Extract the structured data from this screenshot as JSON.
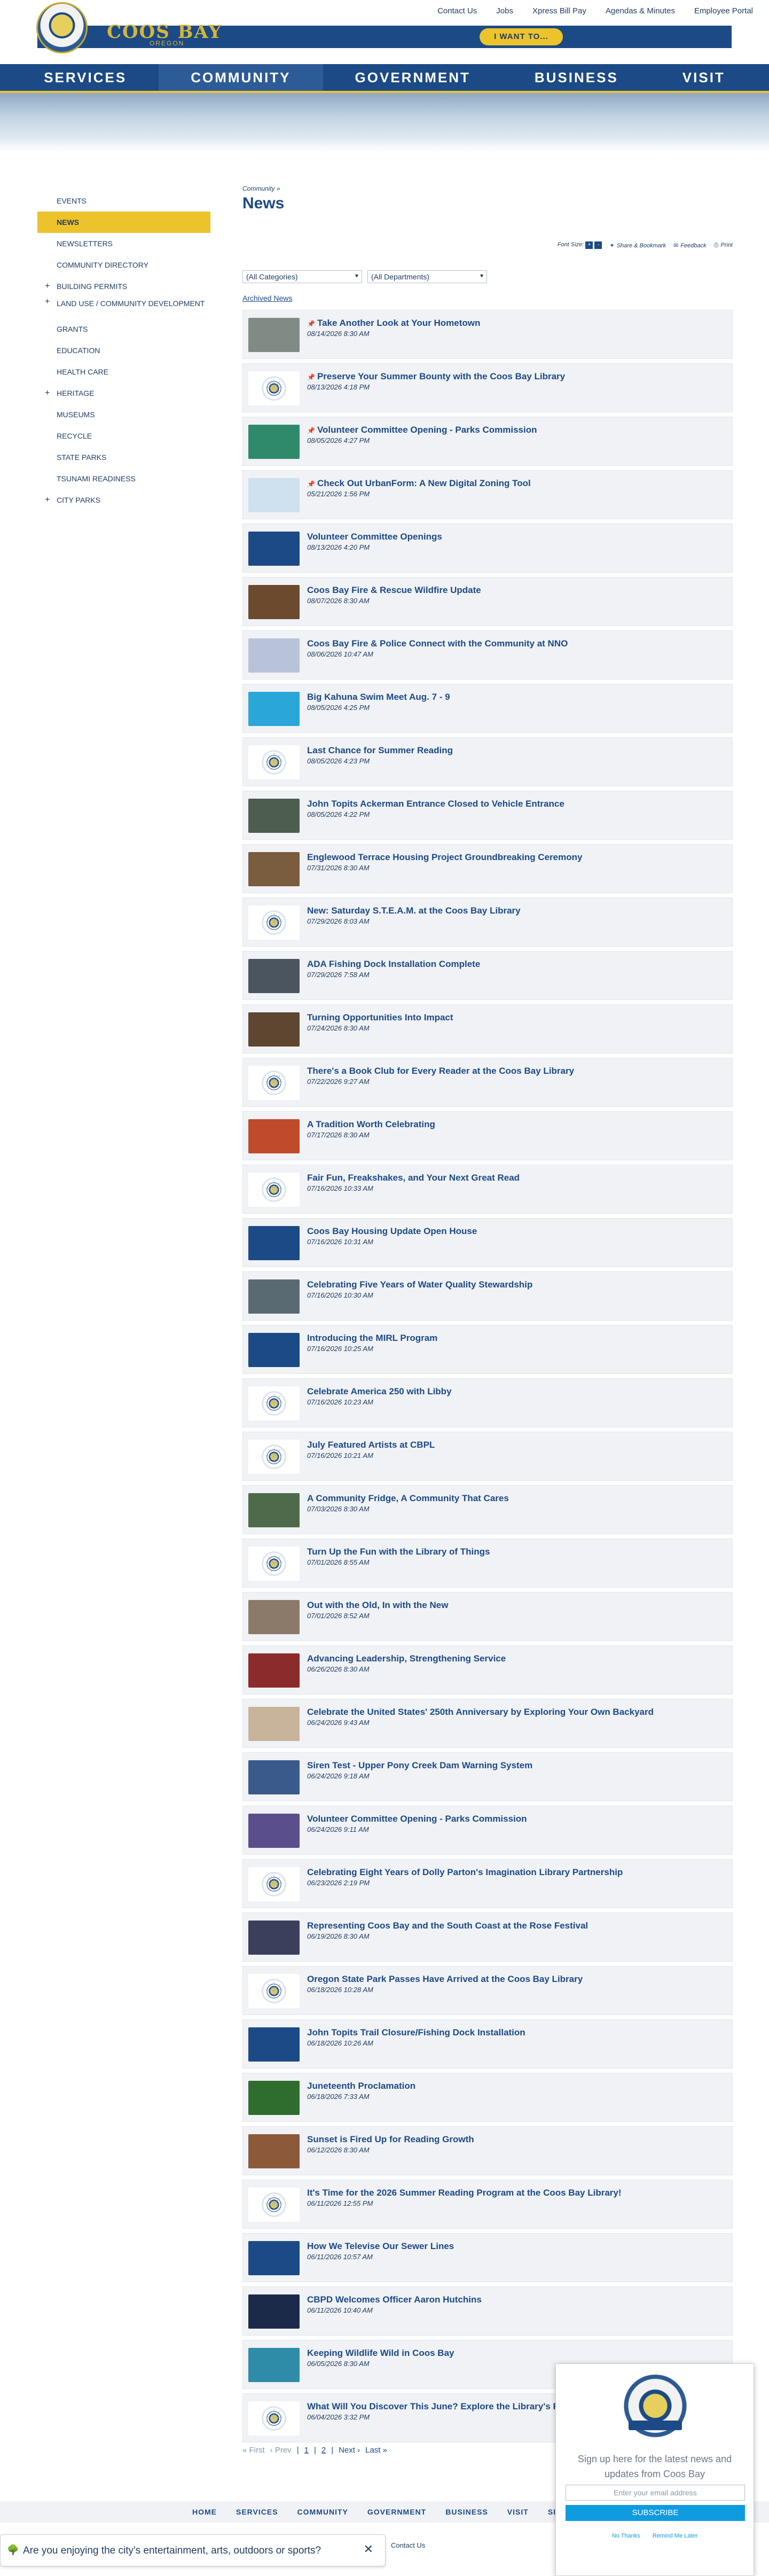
{
  "utility_nav": [
    "Contact Us",
    "Jobs",
    "Xpress Bill Pay",
    "Agendas & Minutes",
    "Employee Portal"
  ],
  "brand": {
    "city_of": "CITY OF",
    "name": "COOS BAY",
    "state": "OREGON",
    "i_want_to": "I WANT TO..."
  },
  "main_nav": [
    "SERVICES",
    "COMMUNITY",
    "GOVERNMENT",
    "BUSINESS",
    "VISIT"
  ],
  "sidebar": [
    {
      "label": "EVENTS",
      "expandable": false
    },
    {
      "label": "NEWS",
      "expandable": false
    },
    {
      "label": "NEWSLETTERS",
      "expandable": false
    },
    {
      "label": "COMMUNITY DIRECTORY",
      "expandable": false
    },
    {
      "label": "BUILDING PERMITS",
      "expandable": true
    },
    {
      "label": "LAND USE / COMMUNITY DEVELOPMENT",
      "expandable": true
    },
    {
      "label": "GRANTS",
      "expandable": false
    },
    {
      "label": "EDUCATION",
      "expandable": false
    },
    {
      "label": "HEALTH CARE",
      "expandable": false
    },
    {
      "label": "HERITAGE",
      "expandable": true
    },
    {
      "label": "MUSEUMS",
      "expandable": false
    },
    {
      "label": "RECYCLE",
      "expandable": false
    },
    {
      "label": "STATE PARKS",
      "expandable": false
    },
    {
      "label": "TSUNAMI READINESS",
      "expandable": false
    },
    {
      "label": "CITY PARKS",
      "expandable": true
    }
  ],
  "breadcrumb": "Community »",
  "page_title": "News",
  "tools": {
    "font_size": "Font Size:",
    "share": "Share & Bookmark",
    "feedback": "Feedback",
    "print": "Print"
  },
  "filters": {
    "categories": "(All Categories)",
    "departments": "(All Departments)"
  },
  "archived": "Archived News",
  "news": [
    {
      "title": "Take Another Look at Your Hometown",
      "date": "08/14/2026 8:30 AM",
      "pinned": true,
      "thumb": "photo"
    },
    {
      "title": "Preserve Your Summer Bounty with the Coos Bay Library",
      "date": "08/13/2026 4:18 PM",
      "pinned": true,
      "thumb": "seal"
    },
    {
      "title": "Volunteer Committee Opening - Parks Commission",
      "date": "08/05/2026 4:27 PM",
      "pinned": true,
      "thumb": "photo"
    },
    {
      "title": "Check Out UrbanForm: A New Digital Zoning Tool",
      "date": "05/21/2026 1:56 PM",
      "pinned": true,
      "thumb": "photo"
    },
    {
      "title": "Volunteer Committee Openings",
      "date": "08/13/2026 4:20 PM",
      "pinned": false,
      "thumb": "photo"
    },
    {
      "title": "Coos Bay Fire & Rescue Wildfire Update",
      "date": "08/07/2026 8:30 AM",
      "pinned": false,
      "thumb": "photo"
    },
    {
      "title": "Coos Bay Fire & Police Connect with the Community at NNO",
      "date": "08/06/2026 10:47 AM",
      "pinned": false,
      "thumb": "photo"
    },
    {
      "title": "Big Kahuna Swim Meet Aug. 7 - 9",
      "date": "08/05/2026 4:25 PM",
      "pinned": false,
      "thumb": "photo"
    },
    {
      "title": "Last Chance for Summer Reading",
      "date": "08/05/2026 4:23 PM",
      "pinned": false,
      "thumb": "seal"
    },
    {
      "title": "John Topits Ackerman Entrance Closed to Vehicle Entrance",
      "date": "08/05/2026 4:22 PM",
      "pinned": false,
      "thumb": "photo"
    },
    {
      "title": "Englewood Terrace Housing Project Groundbreaking Ceremony",
      "date": "07/31/2026 8:30 AM",
      "pinned": false,
      "thumb": "photo"
    },
    {
      "title": "New: Saturday S.T.E.A.M. at the Coos Bay Library",
      "date": "07/29/2026 8:03 AM",
      "pinned": false,
      "thumb": "seal"
    },
    {
      "title": "ADA Fishing Dock Installation Complete",
      "date": "07/29/2026 7:58 AM",
      "pinned": false,
      "thumb": "photo"
    },
    {
      "title": "Turning Opportunities Into Impact",
      "date": "07/24/2026 8:30 AM",
      "pinned": false,
      "thumb": "photo"
    },
    {
      "title": "There's a Book Club for Every Reader at the Coos Bay Library",
      "date": "07/22/2026 9:27 AM",
      "pinned": false,
      "thumb": "seal"
    },
    {
      "title": "A Tradition Worth Celebrating",
      "date": "07/17/2026 8:30 AM",
      "pinned": false,
      "thumb": "photo"
    },
    {
      "title": "Fair Fun, Freakshakes, and Your Next Great Read",
      "date": "07/16/2026 10:33 AM",
      "pinned": false,
      "thumb": "seal"
    },
    {
      "title": "Coos Bay Housing Update Open House",
      "date": "07/16/2026 10:31 AM",
      "pinned": false,
      "thumb": "photo"
    },
    {
      "title": "Celebrating Five Years of Water Quality Stewardship",
      "date": "07/16/2026 10:30 AM",
      "pinned": false,
      "thumb": "photo"
    },
    {
      "title": "Introducing the MIRL Program",
      "date": "07/16/2026 10:25 AM",
      "pinned": false,
      "thumb": "photo"
    },
    {
      "title": "Celebrate America 250 with Libby",
      "date": "07/16/2026 10:23 AM",
      "pinned": false,
      "thumb": "seal"
    },
    {
      "title": "July Featured Artists at CBPL",
      "date": "07/16/2026 10:21 AM",
      "pinned": false,
      "thumb": "seal"
    },
    {
      "title": "A Community Fridge, A Community That Cares",
      "date": "07/03/2026 8:30 AM",
      "pinned": false,
      "thumb": "photo"
    },
    {
      "title": "Turn Up the Fun with the Library of Things",
      "date": "07/01/2026 8:55 AM",
      "pinned": false,
      "thumb": "seal"
    },
    {
      "title": "Out with the Old, In with the New",
      "date": "07/01/2026 8:52 AM",
      "pinned": false,
      "thumb": "photo"
    },
    {
      "title": "Advancing Leadership, Strengthening Service",
      "date": "06/26/2026 8:30 AM",
      "pinned": false,
      "thumb": "photo"
    },
    {
      "title": "Celebrate the United States' 250th Anniversary by Exploring Your Own Backyard",
      "date": "06/24/2026 9:43 AM",
      "pinned": false,
      "thumb": "photo"
    },
    {
      "title": "Siren Test - Upper Pony Creek Dam Warning System",
      "date": "06/24/2026 9:18 AM",
      "pinned": false,
      "thumb": "photo"
    },
    {
      "title": "Volunteer Committee Opening - Parks Commission",
      "date": "06/24/2026 9:11 AM",
      "pinned": false,
      "thumb": "photo"
    },
    {
      "title": "Celebrating Eight Years of Dolly Parton's Imagination Library Partnership",
      "date": "06/23/2026 2:19 PM",
      "pinned": false,
      "thumb": "seal"
    },
    {
      "title": "Representing Coos Bay and the South Coast at the Rose Festival",
      "date": "06/19/2026 8:30 AM",
      "pinned": false,
      "thumb": "photo"
    },
    {
      "title": "Oregon State Park Passes Have Arrived at the Coos Bay Library",
      "date": "06/18/2026 10:28 AM",
      "pinned": false,
      "thumb": "seal"
    },
    {
      "title": "John Topits Trail Closure/Fishing Dock Installation",
      "date": "06/18/2026 10:26 AM",
      "pinned": false,
      "thumb": "photo"
    },
    {
      "title": "Juneteenth Proclamation",
      "date": "06/18/2026 7:33 AM",
      "pinned": false,
      "thumb": "photo"
    },
    {
      "title": "Sunset is Fired Up for Reading Growth",
      "date": "06/12/2026 8:30 AM",
      "pinned": false,
      "thumb": "photo"
    },
    {
      "title": "It's Time for the 2026 Summer Reading Program at the Coos Bay Library!",
      "date": "06/11/2026 12:55 PM",
      "pinned": false,
      "thumb": "seal"
    },
    {
      "title": "How We Televise Our Sewer Lines",
      "date": "06/11/2026 10:57 AM",
      "pinned": false,
      "thumb": "photo"
    },
    {
      "title": "CBPD Welcomes Officer Aaron Hutchins",
      "date": "06/11/2026 10:40 AM",
      "pinned": false,
      "thumb": "photo"
    },
    {
      "title": "Keeping Wildlife Wild in Coos Bay",
      "date": "06/05/2026 8:30 AM",
      "pinned": false,
      "thumb": "photo"
    },
    {
      "title": "What Will You Discover This June? Explore the Library's Fe",
      "date": "06/04/2026 3:32 PM",
      "pinned": false,
      "thumb": "seal"
    }
  ],
  "thumb_colors": [
    "#7f8b84",
    "",
    "#2f8a6b",
    "#cfe0ee",
    "#1c4a86",
    "#6b4a2e",
    "#b8c2d8",
    "#2aa6d8",
    "",
    "#4d5d4e",
    "#7a5c3e",
    "",
    "#4a5560",
    "#5e4630",
    "",
    "#c04a2c",
    "",
    "#1c4a86",
    "#5a6a72",
    "#1c4a86",
    "",
    "",
    "#4e6a4a",
    "",
    "#8b7a6a",
    "#8c2b2b",
    "#c8b49a",
    "#3b5a8c",
    "#5b4e8c",
    "",
    "#3b3f5c",
    "",
    "#1c4a86",
    "#2f6d2f",
    "#8c5a3a",
    "",
    "#1c4a86",
    "#1c2a4a",
    "#2f8ca8",
    ""
  ],
  "pager": {
    "first": "« First",
    "prev": "‹ Prev",
    "p1": "1",
    "p2": "2",
    "next": "Next ›",
    "last": "Last »"
  },
  "footer_nav": [
    "HOME",
    "SERVICES",
    "COMMUNITY",
    "GOVERNMENT",
    "BUSINESS",
    "VISIT",
    "SITE"
  ],
  "contact": "Contact Us",
  "survey": "Are you enjoying the city's entertainment, arts, outdoors or sports?",
  "popup": {
    "text": "Sign up here for the latest news and updates from Coos Bay",
    "placeholder": "Enter your email address",
    "subscribe": "SUBSCRIBE",
    "no_thanks": "No Thanks",
    "remind": "Remind Me Later"
  }
}
